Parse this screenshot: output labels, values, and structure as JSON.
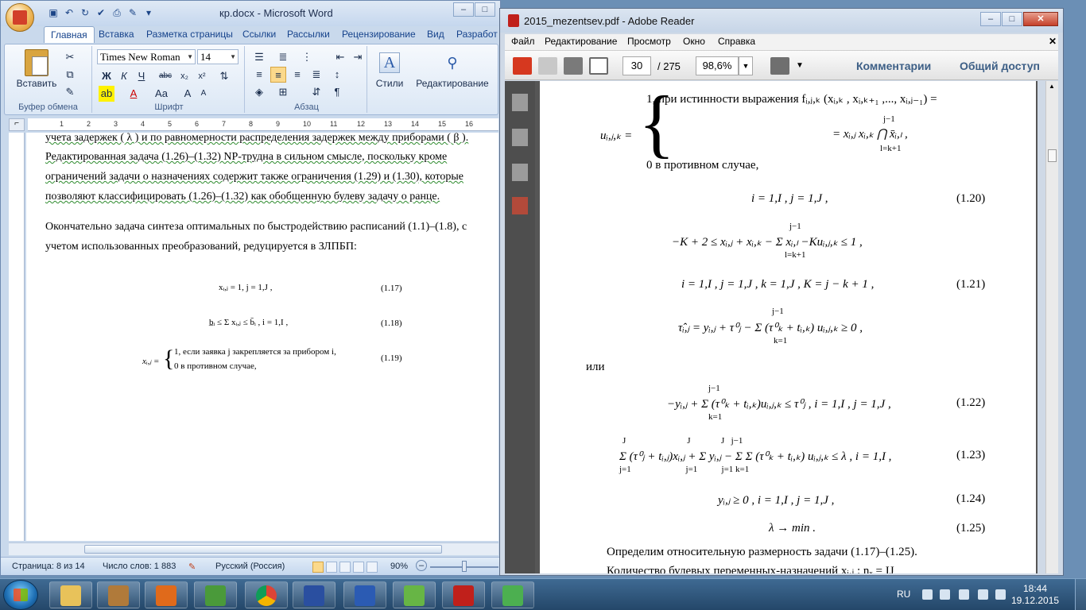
{
  "word": {
    "title": "кр.docx - Microsoft Word",
    "tabs": [
      "Главная",
      "Вставка",
      "Разметка страницы",
      "Ссылки",
      "Рассылки",
      "Рецензирование",
      "Вид",
      "Разработ"
    ],
    "clipboard": {
      "paste": "Вставить",
      "label": "Буфер обмена"
    },
    "font": {
      "name": "Times New Roman",
      "size": "14",
      "label": "Шрифт"
    },
    "paragraph_label": "Абзац",
    "styles": "Стили",
    "editing": "Редактирование",
    "ruler_numbers": [
      "1",
      "2",
      "3",
      "4",
      "5",
      "6",
      "7",
      "8",
      "9",
      "10",
      "11",
      "12",
      "13",
      "14",
      "15",
      "16"
    ],
    "doc": {
      "p1_line1": "учета задержек ( λ ) и по равномерности   распределения задержек между приборами ( β ).",
      "p1_line2": "Редактированная задача (1.26)–(1.32) NP-трудна в сильном смысле, поскольку кроме",
      "p1_line3": "ограничений задачи о назначениях содержит также ограничения (1.29) и (1.30), которые",
      "p1_line4": "позволяют классифицировать (1.26)–(1.32) как обобщенную булеву задачу о ранце.",
      "p2_line1": "Окончательно задача синтеза оптимальных по быстродействию расписаний (1.1)–(1.8), с",
      "p2_line2": "учетом использованных преобразований, редуцируется в ЗЛПБП:",
      "f17": "xᵢ,ⱼ = 1,  j = 1,J ,",
      "f17_num": "(1.17)",
      "f18": "b̲ᵢ ≤ Σ xᵢ,ⱼ ≤ b̄ᵢ ,  i = 1,I ,",
      "f18_num": "(1.18)",
      "f19_line1": "1,  если  заявка j  закрепляется за  прибором   i,",
      "f19_line2": "0    в противном  случае,",
      "f19_lhs": "xᵢ,ⱼ =",
      "f19_num": "(1.19)"
    },
    "status": {
      "page": "Страница: 8 из 14",
      "words": "Число слов: 1 883",
      "lang": "Русский (Россия)",
      "zoom": "90%"
    }
  },
  "reader": {
    "title": "2015_mezentsev.pdf - Adobe Reader",
    "menu": [
      "Файл",
      "Редактирование",
      "Просмотр",
      "Окно",
      "Справка"
    ],
    "page_current": "30",
    "page_total": "/ 275",
    "zoom": "98,6%",
    "comments": "Комментарии",
    "share": "Общий доступ",
    "pdf": {
      "u_lhs": "uᵢ,ⱼ,ₖ =",
      "u_case1": "1,  при   истинности   выражения   fᵢ,ⱼ,ₖ (xᵢ,ₖ , xᵢ,ₖ₊₁ ,..., xᵢ,ⱼ₋₁) =",
      "u_case1b": "= xᵢ,ⱼ xᵢ,ₖ  ⋂  x̄ᵢ,ₗ ,",
      "u_case1b_top": "j−1",
      "u_case1b_bot": "l=k+1",
      "u_case2": "0    в противном  случае,",
      "e20": "i = 1,I ,  j = 1,J ,",
      "n20": "(1.20)",
      "e21a": "−K + 2 ≤ xᵢ,ⱼ + xᵢ,ₖ − Σ xᵢ,ₗ  −Kuᵢ,ⱼ,ₖ ≤ 1 ,",
      "e21a_top": "j−1",
      "e21a_bot": "l=k+1",
      "e21b": "i = 1,I ,  j = 1,J ,  k = 1,J ,  K = j − k + 1 ,",
      "n21": "(1.21)",
      "e_tau": "τ̂ᵢ,ⱼ = yᵢ,ⱼ + τ⁰ⱼ − Σ (τ⁰ₖ + tᵢ,ₖ) uᵢ,ⱼ,ₖ ≥ 0 ,",
      "e_tau_top": "j−1",
      "e_tau_bot": "k=1",
      "or": "или",
      "e22": "−yᵢ,ⱼ + Σ (τ⁰ₖ + tᵢ,ₖ)uᵢ,ⱼ,ₖ ≤ τ⁰ⱼ ,  i = 1,I ,   j = 1,J ,",
      "e22_top": "j−1",
      "e22_bot": "k=1",
      "n22": "(1.22)",
      "e23": "Σ (τ⁰ⱼ + tᵢ,ⱼ)xᵢ,ⱼ + Σ yᵢ,ⱼ − Σ Σ (τ⁰ₖ + tᵢ,ₖ) uᵢ,ⱼ,ₖ ≤ λ , i = 1,I ,",
      "e23_top": "J                            J              J   j−1",
      "e23_bot": "j=1                         j=1           j=1 k=1",
      "n23": "(1.23)",
      "e24": "yᵢ,ⱼ ≥ 0 ,  i = 1,I ,  j = 1,J ,",
      "n24": "(1.24)",
      "e25": "λ → min .",
      "n25": "(1.25)",
      "t1": "Определим относительную размерность задачи (1.17)–(1.25).",
      "t2": "Количество булевых переменных-назначений  xᵢ,ⱼ  :  nₓ = IJ"
    }
  },
  "taskbar": {
    "lang": "RU",
    "time": "18:44",
    "date": "19.12.2015"
  },
  "colors": {
    "word_accent": "#15428b",
    "adobe_red": "#c0201b",
    "taskbar": "#2f5a82"
  }
}
